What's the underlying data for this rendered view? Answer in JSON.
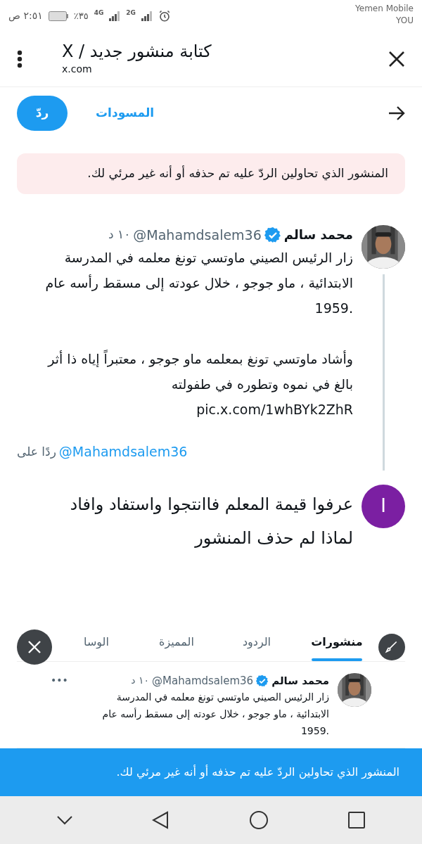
{
  "status_bar": {
    "time": "٢:٥١ ص",
    "battery": "٪٣٥",
    "network_1": "4G",
    "network_2": "2G",
    "carrier": "Yemen Mobile",
    "carrier_2": "YOU"
  },
  "browser": {
    "title": "كتابة منشور جديد / X",
    "url": "x.com"
  },
  "toolbar": {
    "drafts": "المسودات",
    "reply_button": "ردّ"
  },
  "notice": ".المنشور الذي تحاولين الردّ عليه تم حذفه أو أنه غير مرئي لك",
  "tweet": {
    "name": "محمد سالم",
    "verified": true,
    "handle": "@Mahamdsalem36",
    "time": "١٠ د",
    "text": "زار الرئيس الصيني ماوتسي تونغ معلمه في المدرسة\nالابتدائية ، ماو جوجو ، خلال عودته إلى مسقط رأسه عام\n.1959\n\nوأشاد ماوتسي تونغ بمعلمه ماو جوجو ، معتبراً إياه ذا أثر\nبالغ في نموه وتطوره في طفولته\npic.x.com/1whBYk2ZhR"
  },
  "replying_to": {
    "handle": "@Mahamdsalem36",
    "label": "ردًا على"
  },
  "composer": {
    "avatar_letter": "I",
    "value": "عرفوا قيمة المعلم فاانتجوا واستفاد وافاد\nلماذا لم حذف المنشور"
  },
  "attachment": {
    "tabs": [
      {
        "label": "منشورات",
        "selected": true
      },
      {
        "label": "الردود",
        "selected": false
      },
      {
        "label": "المميزة",
        "selected": false
      },
      {
        "label": "الوسا",
        "selected": false
      }
    ],
    "tweet": {
      "name": "محمد سالم",
      "verified": true,
      "handle": "@Mahamdsalem36",
      "time": "١٠ د",
      "more": "•••",
      "text": "زار الرئيس الصيني ماوتسي تونغ معلمه في المدرسة\nالابتدائية ، ماو جوجو ، خلال عودته إلى مسقط رأسه عام\n.1959"
    }
  },
  "toast": ".المنشور الذي تحاولين الردّ عليه تم حذفه أو أنه غير مرئي لك"
}
